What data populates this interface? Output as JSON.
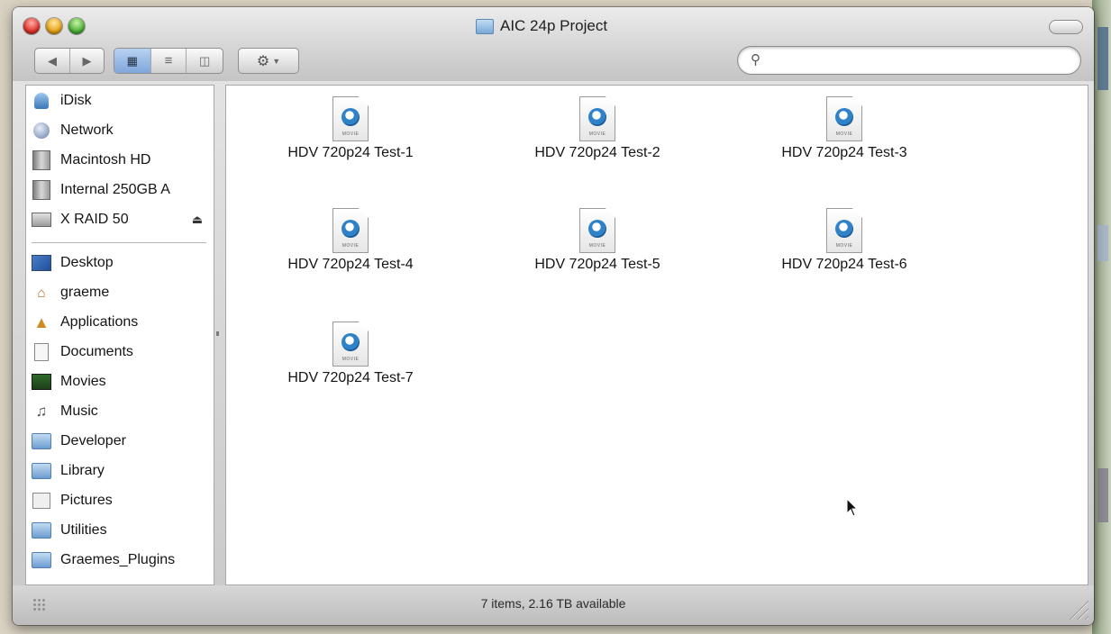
{
  "window": {
    "title": "AIC 24p Project",
    "title_icon": "folder-icon"
  },
  "toolbar": {
    "back_forward": [
      "◀",
      "▶"
    ],
    "view_modes": [
      "icon-view",
      "list-view",
      "column-view"
    ],
    "action_menu_icon": "gear-icon",
    "search": {
      "value": "",
      "placeholder": ""
    }
  },
  "sidebar": {
    "devices": [
      {
        "label": "iDisk",
        "icon": "idisk-icon"
      },
      {
        "label": "Network",
        "icon": "network-globe-icon"
      },
      {
        "label": "Macintosh HD",
        "icon": "hard-drive-icon"
      },
      {
        "label": "Internal 250GB A",
        "icon": "hard-drive-icon"
      },
      {
        "label": "X RAID 50",
        "icon": "hard-drive-icon",
        "eject": "⏏"
      }
    ],
    "places": [
      {
        "label": "Desktop",
        "icon": "desktop-icon"
      },
      {
        "label": "graeme",
        "icon": "home-icon"
      },
      {
        "label": "Applications",
        "icon": "applications-icon"
      },
      {
        "label": "Documents",
        "icon": "documents-icon"
      },
      {
        "label": "Movies",
        "icon": "movies-icon"
      },
      {
        "label": "Music",
        "icon": "music-icon"
      },
      {
        "label": "Developer",
        "icon": "developer-folder-icon"
      },
      {
        "label": "Library",
        "icon": "library-folder-icon"
      },
      {
        "label": "Pictures",
        "icon": "pictures-icon"
      },
      {
        "label": "Utilities",
        "icon": "utilities-folder-icon"
      },
      {
        "label": "Graemes_Plugins",
        "icon": "folder-icon"
      }
    ]
  },
  "files": [
    {
      "name": "HDV 720p24 Test-1",
      "icon": "quicktime-movie-icon"
    },
    {
      "name": "HDV 720p24 Test-2",
      "icon": "quicktime-movie-icon"
    },
    {
      "name": "HDV 720p24 Test-3",
      "icon": "quicktime-movie-icon"
    },
    {
      "name": "HDV 720p24 Test-4",
      "icon": "quicktime-movie-icon"
    },
    {
      "name": "HDV 720p24 Test-5",
      "icon": "quicktime-movie-icon"
    },
    {
      "name": "HDV 720p24 Test-6",
      "icon": "quicktime-movie-icon"
    },
    {
      "name": "HDV 720p24 Test-7",
      "icon": "quicktime-movie-icon"
    }
  ],
  "file_icon_tag": "MOVIE",
  "status": {
    "text": "7 items, 2.16 TB available"
  },
  "colors": {
    "selection_blue": "#7fa6db",
    "window_chrome": "#d5d5d5"
  }
}
